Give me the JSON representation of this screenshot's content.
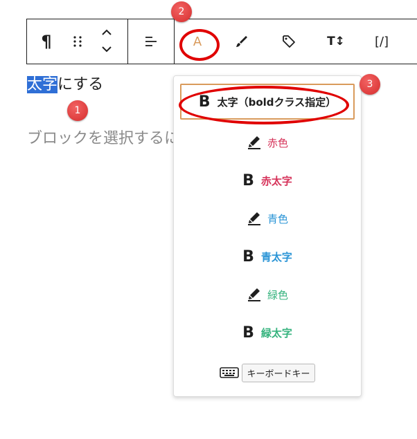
{
  "toolbar": {
    "paragraph_icon": "¶",
    "format_a_label": "A",
    "tt_label": "T↕",
    "shortcode_label": "[/]"
  },
  "editor": {
    "selected_text": "太字",
    "rest_text": "にする",
    "placeholder": "ブロックを選択するには"
  },
  "annotations": {
    "badge1": "1",
    "badge2": "2",
    "badge3": "3"
  },
  "dropdown": {
    "items": [
      {
        "icon": "B",
        "label": "太字（boldクラス指定）",
        "color": "#1e1e1e"
      },
      {
        "icon": "pen",
        "label": "赤色",
        "color": "#d6335a"
      },
      {
        "icon": "B",
        "label": "赤太字",
        "color": "#d6335a"
      },
      {
        "icon": "pen",
        "label": "青色",
        "color": "#2a94d6"
      },
      {
        "icon": "B",
        "label": "青太字",
        "color": "#2a94d6"
      },
      {
        "icon": "pen",
        "label": "緑色",
        "color": "#36b37e"
      },
      {
        "icon": "B",
        "label": "緑太字",
        "color": "#36b37e"
      }
    ],
    "keyboard_label": "キーボードキー"
  },
  "colors": {
    "accent_orange": "#d99a5b",
    "annotation_red": "#e00000",
    "selection_blue": "#2f6fd6"
  }
}
